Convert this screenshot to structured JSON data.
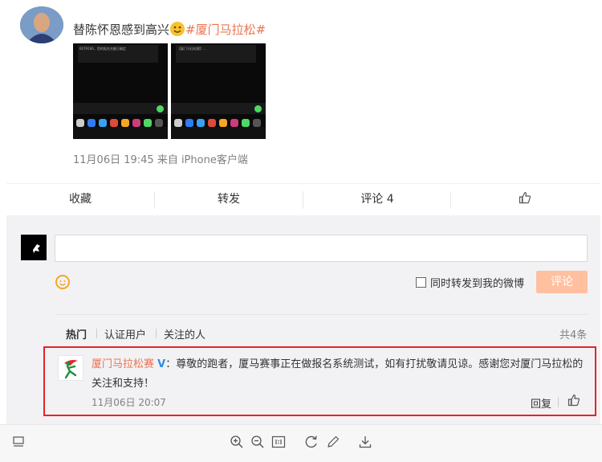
{
  "window": {
    "minimize": "—",
    "maximize": "☐",
    "close": "✕"
  },
  "post": {
    "text": "替陈怀恩感到高兴",
    "hashtag": "#厦门马拉松#",
    "meta": "11月06日 19:45  来自 iPhone客户端",
    "thumb1_caption": "6079166，您的报名名额已确定",
    "thumb2_caption": "【厦门马拉松赛】…"
  },
  "actions": {
    "favorite": "收藏",
    "repost": "转发",
    "comment": "评论 4"
  },
  "composer": {
    "placeholder": "",
    "repost_option": "同时转发到我的微博",
    "submit": "评论"
  },
  "filters": {
    "hot": "热门",
    "verified": "认证用户",
    "following": "关注的人",
    "total": "共4条"
  },
  "comment": {
    "author": "厦门马拉松赛",
    "verified_badge": "V",
    "body": "：尊敬的跑者，厦马赛事正在做报名系统测试，如有打扰敬请见谅。感谢您对厦门马拉松的关注和支持！",
    "time": "11月06日 20:07",
    "reply": "回复"
  },
  "colors": {
    "accent": "#eb7350",
    "highlight_border": "#e0262b",
    "verified_blue": "#2a8ce5",
    "submit_disabled": "#ffc09f"
  }
}
